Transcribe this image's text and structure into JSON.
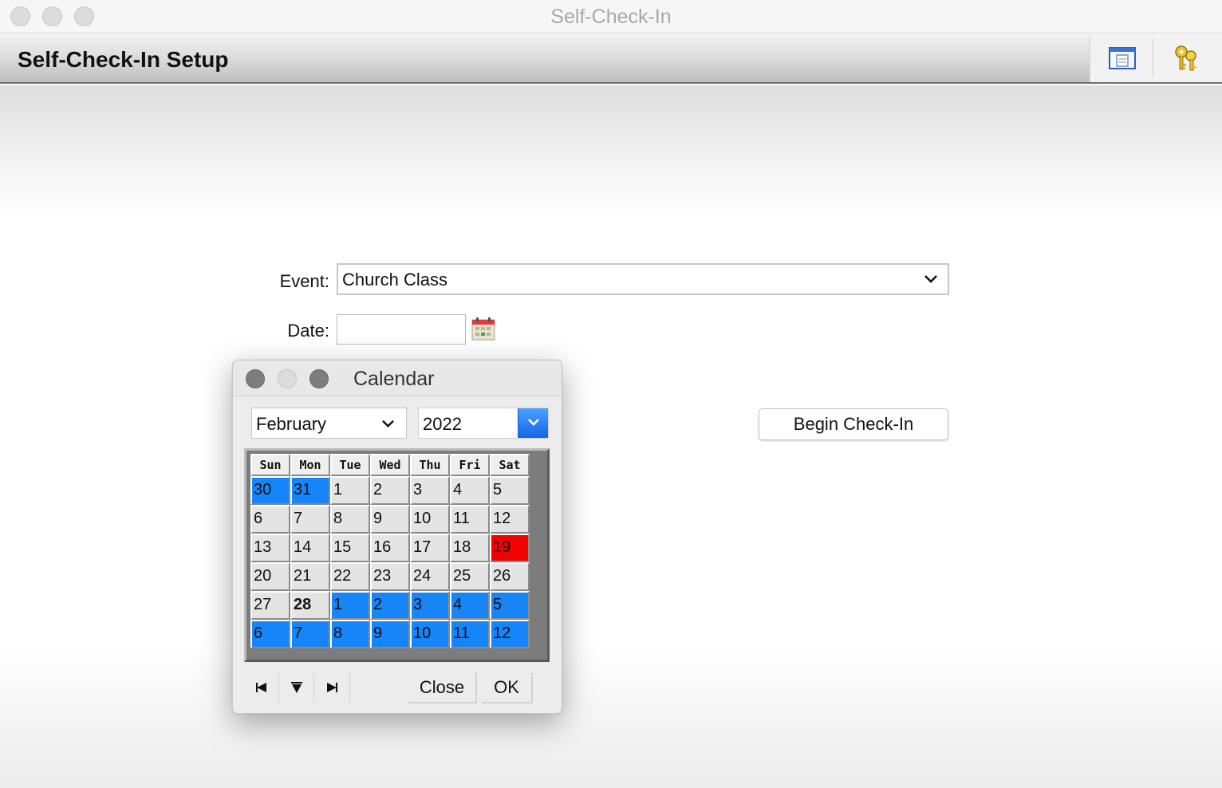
{
  "window": {
    "title": "Self-Check-In"
  },
  "header": {
    "title": "Self-Check-In Setup",
    "tools": [
      "document-window-icon",
      "keys-icon"
    ]
  },
  "form": {
    "event_label": "Event:",
    "event_value": "Church Class",
    "date_label": "Date:",
    "date_value": "",
    "begin_label": "Begin Check-In"
  },
  "calendar": {
    "title": "Calendar",
    "month": "February",
    "year": "2022",
    "weekdays": [
      "Sun",
      "Mon",
      "Tue",
      "Wed",
      "Thu",
      "Fri",
      "Sat"
    ],
    "weeks": [
      [
        {
          "d": "30",
          "s": "other"
        },
        {
          "d": "31",
          "s": "other"
        },
        {
          "d": "1"
        },
        {
          "d": "2"
        },
        {
          "d": "3"
        },
        {
          "d": "4"
        },
        {
          "d": "5"
        }
      ],
      [
        {
          "d": "6"
        },
        {
          "d": "7"
        },
        {
          "d": "8"
        },
        {
          "d": "9"
        },
        {
          "d": "10"
        },
        {
          "d": "11"
        },
        {
          "d": "12"
        }
      ],
      [
        {
          "d": "13"
        },
        {
          "d": "14"
        },
        {
          "d": "15"
        },
        {
          "d": "16"
        },
        {
          "d": "17"
        },
        {
          "d": "18"
        },
        {
          "d": "19",
          "s": "today"
        }
      ],
      [
        {
          "d": "20"
        },
        {
          "d": "21"
        },
        {
          "d": "22"
        },
        {
          "d": "23"
        },
        {
          "d": "24"
        },
        {
          "d": "25"
        },
        {
          "d": "26"
        }
      ],
      [
        {
          "d": "27"
        },
        {
          "d": "28",
          "s": "bold"
        },
        {
          "d": "1",
          "s": "other"
        },
        {
          "d": "2",
          "s": "other"
        },
        {
          "d": "3",
          "s": "other"
        },
        {
          "d": "4",
          "s": "other"
        },
        {
          "d": "5",
          "s": "other"
        }
      ],
      [
        {
          "d": "6",
          "s": "other"
        },
        {
          "d": "7",
          "s": "other"
        },
        {
          "d": "8",
          "s": "other"
        },
        {
          "d": "9",
          "s": "other"
        },
        {
          "d": "10",
          "s": "other"
        },
        {
          "d": "11",
          "s": "other"
        },
        {
          "d": "12",
          "s": "other"
        }
      ]
    ],
    "nav": [
      "prev-month-icon",
      "current-month-icon",
      "next-month-icon"
    ],
    "close_label": "Close",
    "ok_label": "OK"
  },
  "colors": {
    "other_month": "#1685f8",
    "today": "#f20000",
    "year_arrow": "#1567e6"
  }
}
